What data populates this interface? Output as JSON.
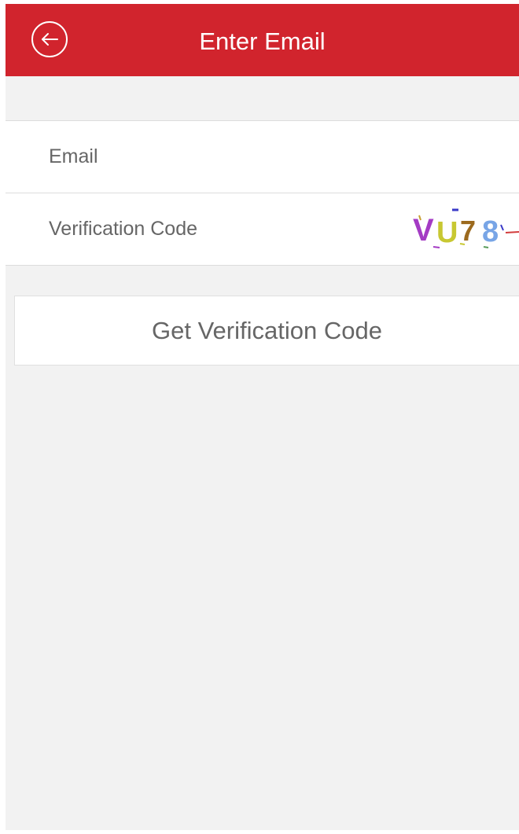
{
  "header": {
    "title": "Enter Email",
    "background": "#d1242d",
    "back_icon": "arrow-left-circle-icon"
  },
  "form": {
    "email_placeholder": "Email",
    "email_value": "",
    "code_placeholder": "Verification Code",
    "code_value": "",
    "captcha": {
      "text": "VU78",
      "colors": [
        "#a43bc4",
        "#c8c832",
        "#9c6a1e",
        "#78a5e6"
      ]
    }
  },
  "actions": {
    "get_code_label": "Get Verification Code"
  }
}
